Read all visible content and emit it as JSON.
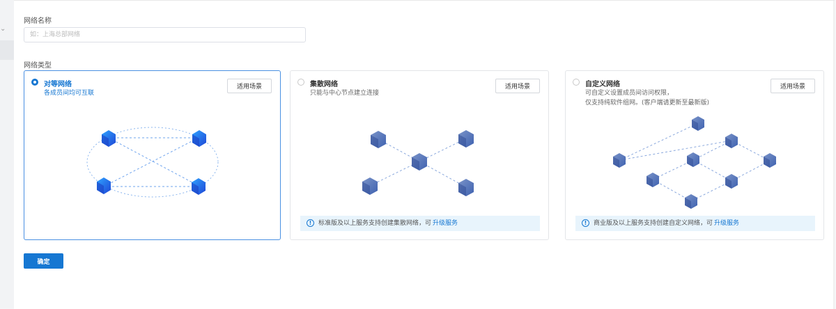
{
  "form": {
    "name_label": "网络名称",
    "name_placeholder": "如：上海总部网络",
    "name_value": "",
    "type_label": "网络类型",
    "submit_label": "确定"
  },
  "cards": [
    {
      "title": "对等网络",
      "desc_line1": "各成员间均可互联",
      "desc_line2": "",
      "button": "适用场景",
      "selected": true
    },
    {
      "title": "集散网络",
      "desc_line1": "只能与中心节点建立连接",
      "desc_line2": "",
      "button": "适用场景",
      "selected": false,
      "notice_text": "标准版及以上服务支持创建集散网络，可",
      "notice_link": "升级服务"
    },
    {
      "title": "自定义网络",
      "desc_line1": "可自定义设置成员间访问权限，",
      "desc_line2": "仅支持纯软件组网。(客户端请更新至最新版)",
      "button": "适用场景",
      "selected": false,
      "notice_text": "商业版及以上服务支持创建自定义网络，可",
      "notice_link": "升级服务"
    }
  ],
  "colors": {
    "primary": "#1677d2",
    "notice_bg": "#e8f4fc",
    "selected_border": "#4a90e2"
  }
}
